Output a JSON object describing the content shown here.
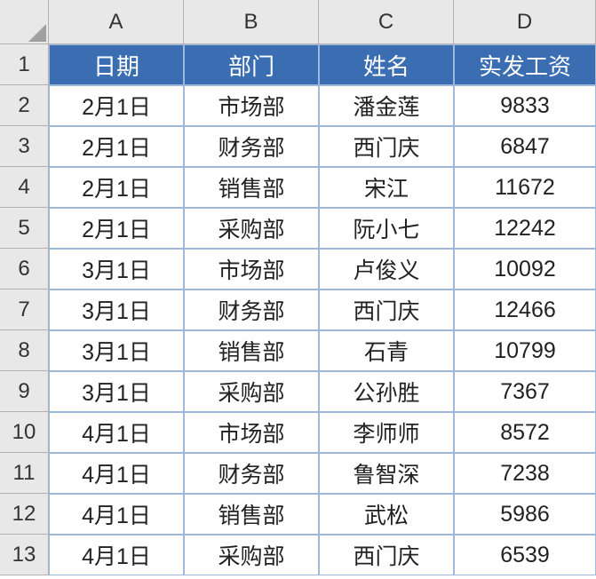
{
  "columns": [
    "A",
    "B",
    "C",
    "D"
  ],
  "rowNumbers": [
    "1",
    "2",
    "3",
    "4",
    "5",
    "6",
    "7",
    "8",
    "9",
    "10",
    "11",
    "12",
    "13"
  ],
  "headers": {
    "date": "日期",
    "department": "部门",
    "name": "姓名",
    "salary": "实发工资"
  },
  "rows": [
    {
      "date": "2月1日",
      "department": "市场部",
      "name": "潘金莲",
      "salary": "9833"
    },
    {
      "date": "2月1日",
      "department": "财务部",
      "name": "西门庆",
      "salary": "6847"
    },
    {
      "date": "2月1日",
      "department": "销售部",
      "name": "宋江",
      "salary": "11672"
    },
    {
      "date": "2月1日",
      "department": "采购部",
      "name": "阮小七",
      "salary": "12242"
    },
    {
      "date": "3月1日",
      "department": "市场部",
      "name": "卢俊义",
      "salary": "10092"
    },
    {
      "date": "3月1日",
      "department": "财务部",
      "name": "西门庆",
      "salary": "12466"
    },
    {
      "date": "3月1日",
      "department": "销售部",
      "name": "石青",
      "salary": "10799"
    },
    {
      "date": "3月1日",
      "department": "采购部",
      "name": "公孙胜",
      "salary": "7367"
    },
    {
      "date": "4月1日",
      "department": "市场部",
      "name": "李师师",
      "salary": "8572"
    },
    {
      "date": "4月1日",
      "department": "财务部",
      "name": "鲁智深",
      "salary": "7238"
    },
    {
      "date": "4月1日",
      "department": "销售部",
      "name": "武松",
      "salary": "5986"
    },
    {
      "date": "4月1日",
      "department": "采购部",
      "name": "西门庆",
      "salary": "6539"
    }
  ],
  "chart_data": {
    "type": "table",
    "title": "",
    "columns": [
      "日期",
      "部门",
      "姓名",
      "实发工资"
    ],
    "data": [
      [
        "2月1日",
        "市场部",
        "潘金莲",
        9833
      ],
      [
        "2月1日",
        "财务部",
        "西门庆",
        6847
      ],
      [
        "2月1日",
        "销售部",
        "宋江",
        11672
      ],
      [
        "2月1日",
        "采购部",
        "阮小七",
        12242
      ],
      [
        "3月1日",
        "市场部",
        "卢俊义",
        10092
      ],
      [
        "3月1日",
        "财务部",
        "西门庆",
        12466
      ],
      [
        "3月1日",
        "销售部",
        "石青",
        10799
      ],
      [
        "3月1日",
        "采购部",
        "公孙胜",
        7367
      ],
      [
        "4月1日",
        "市场部",
        "李师师",
        8572
      ],
      [
        "4月1日",
        "财务部",
        "鲁智深",
        7238
      ],
      [
        "4月1日",
        "销售部",
        "武松",
        5986
      ],
      [
        "4月1日",
        "采购部",
        "西门庆",
        6539
      ]
    ]
  }
}
